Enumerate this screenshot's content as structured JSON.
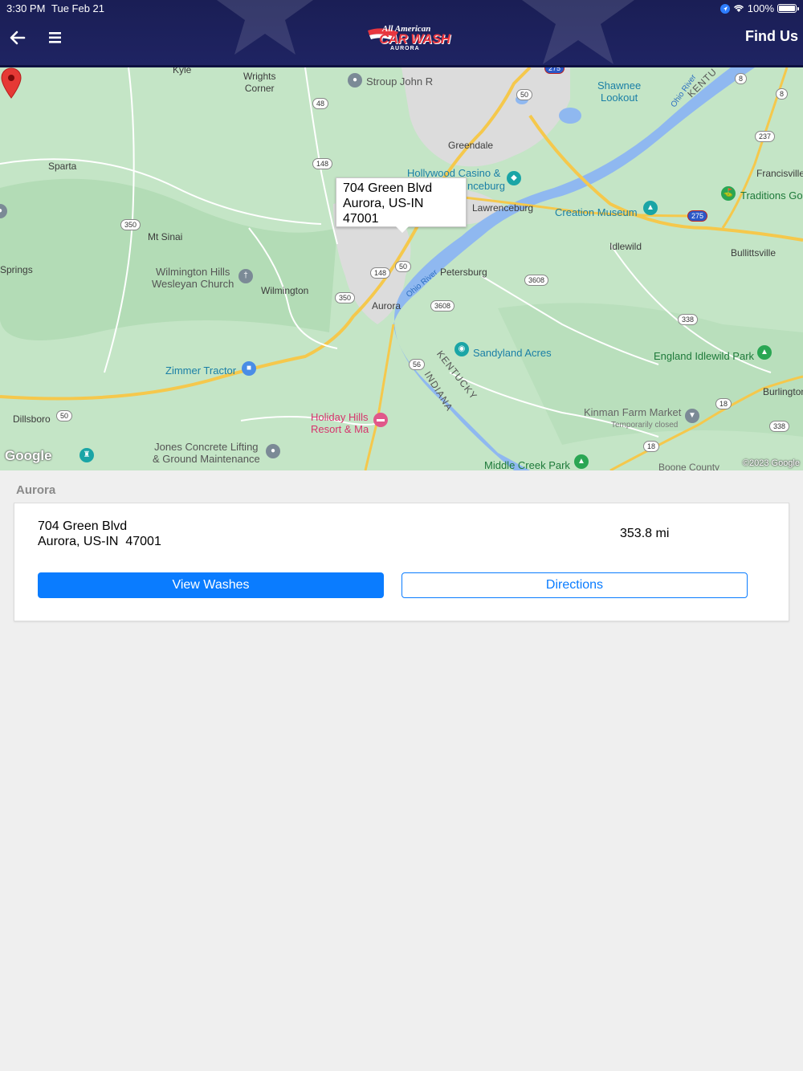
{
  "status_bar": {
    "time": "3:30 PM",
    "date": "Tue Feb 21",
    "battery": "100%"
  },
  "header": {
    "logo_top": "All American",
    "logo_main": "CAR WASH",
    "logo_sub": "AURORA",
    "find_us_label": "Find Us"
  },
  "map": {
    "callout": {
      "line1": "704 Green Blvd",
      "line2": "Aurora, US-IN",
      "line3": "47001"
    },
    "labels": {
      "kyle": "Kyle",
      "wrights_corner": "Wrights\nCorner",
      "stroup": "Stroup John R",
      "shawnee": "Shawnee\nLookout",
      "greendale": "Greendale",
      "hollywood": "Hollywood Casino &",
      "hollywood2": "nceburg",
      "sparta": "Sparta",
      "lawrenceburg": "Lawrenceburg",
      "creation_museum": "Creation Museum",
      "francisville": "Francisville",
      "traditions": "Traditions Go",
      "mt_sinai": "Mt Sinai",
      "idlewild": "Idlewild",
      "bullittsville": "Bullittsville",
      "springs": "Springs",
      "wilmington_hills": "Wilmington Hills\nWesleyan Church",
      "wilmington": "Wilmington",
      "petersburg": "Petersburg",
      "aurora": "Aurora",
      "ohio_river": "Ohio River",
      "ohio_river2": "Ohio River",
      "kentucky": "KENTUCKY",
      "kentucky_top": "KENTU",
      "indiana": "INDIANA",
      "sandyland": "Sandyland Acres",
      "england": "England Idlewild Park",
      "zimmer": "Zimmer Tractor",
      "burlington": "Burlington",
      "dillsboro": "Dillsboro",
      "holiday": "Holiday Hills\nResort & Ma",
      "kinman": "Kinman Farm Market",
      "kinman_closed": "Temporarily closed",
      "jones": "Jones Concrete Lifting\n& Ground Maintenance",
      "middle_creek": "Middle Creek Park",
      "boone": "Boone County"
    },
    "shields": [
      "48",
      "50",
      "148",
      "350",
      "148",
      "350",
      "3608",
      "3608",
      "56",
      "50",
      "338",
      "18",
      "338",
      "18",
      "237",
      "8",
      "8",
      "275",
      "275",
      "50"
    ],
    "google": "Google",
    "credit": "©2023 Google"
  },
  "location": {
    "section_title": "Aurora",
    "address_line1": "704 Green Blvd",
    "address_line2": "Aurora, US-IN  47001",
    "distance": "353.8 mi",
    "view_washes_label": "View Washes",
    "directions_label": "Directions"
  },
  "colors": {
    "header": "#1f2463",
    "accent": "#0a7cff",
    "logo_red": "#e8363f",
    "pin": "#e53935"
  }
}
